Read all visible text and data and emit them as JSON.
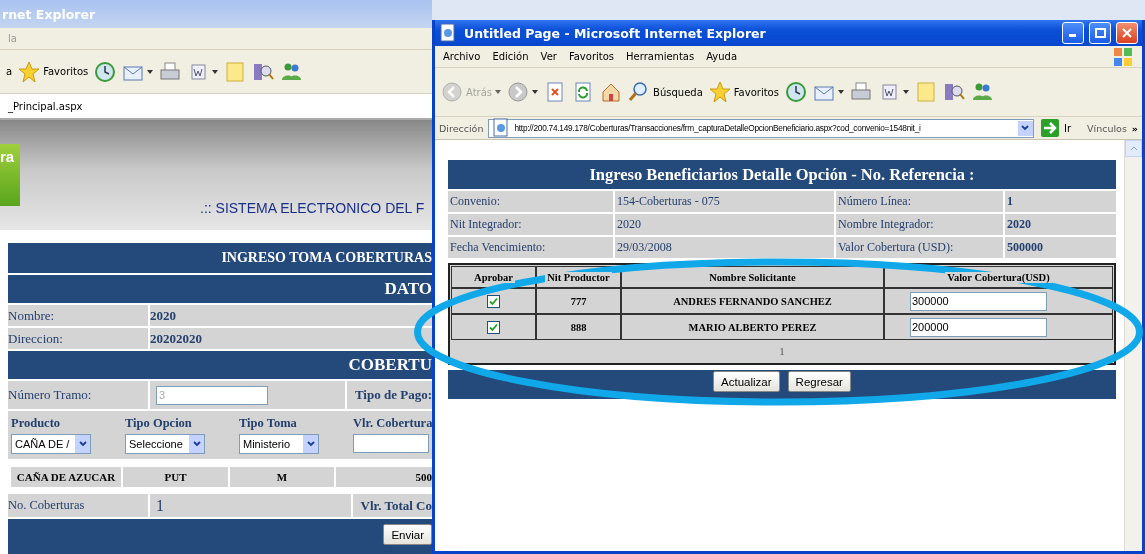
{
  "back_window": {
    "title": "rnet Explorer",
    "menu": [
      "la"
    ],
    "toolbar": [
      {
        "kind": "text",
        "label": "a"
      },
      {
        "kind": "star",
        "label": "Favoritos"
      },
      {
        "kind": "history"
      },
      {
        "kind": "mail",
        "dropdown": true
      },
      {
        "kind": "print"
      },
      {
        "kind": "word",
        "dropdown": true
      },
      {
        "kind": "note"
      },
      {
        "kind": "research"
      },
      {
        "kind": "messenger"
      }
    ],
    "address": "_Principal.aspx",
    "banner": {
      "logo": "ra",
      "title": ".:: SISTEMA ELECTRONICO DEL F"
    },
    "page": {
      "header": "INGRESO TOMA COBERTURAS",
      "section_1": "DATO",
      "fields": [
        {
          "label": "Nombre:",
          "value": "2020"
        },
        {
          "label": "Direccion:",
          "value": "20202020"
        }
      ],
      "section_2": "COBERTU",
      "tramo": {
        "label": "Número Tramo:",
        "value": "3",
        "disabled": true
      },
      "tipo_pago_label": "Tipo de Pago:",
      "selects": [
        {
          "label": "Producto",
          "value": "CAÑA DE /"
        },
        {
          "label": "Tipo Opcion",
          "value": "Seleccione"
        },
        {
          "label": "Tipo Toma",
          "value": "Ministerio"
        }
      ],
      "vlr_label": "Vlr. Cobertura",
      "grid_row": [
        "CAÑA DE AZUCAR",
        "PUT",
        "M",
        "500"
      ],
      "count": {
        "label": "No. Coberturas",
        "value": "1"
      },
      "total_label": "Vlr. Total Co",
      "button": "Enviar"
    }
  },
  "front_window": {
    "title": "Untitled Page - Microsoft Internet Explorer",
    "menu": [
      "Archivo",
      "Edición",
      "Ver",
      "Favoritos",
      "Herramientas",
      "Ayuda"
    ],
    "toolbar": [
      {
        "kind": "back",
        "label": "Atrás",
        "dropdown": true,
        "disabled": true
      },
      {
        "kind": "forward",
        "dropdown": true,
        "disabled": false
      },
      {
        "kind": "stop",
        "disabled": false
      },
      {
        "kind": "refresh",
        "disabled": false
      },
      {
        "kind": "home",
        "disabled": false
      },
      {
        "kind": "search",
        "label": "Búsqueda",
        "disabled": false
      },
      {
        "kind": "star",
        "label": "Favoritos",
        "disabled": false
      },
      {
        "kind": "history",
        "disabled": false
      },
      {
        "kind": "mail",
        "dropdown": true,
        "disabled": false
      },
      {
        "kind": "print",
        "disabled": false
      },
      {
        "kind": "word",
        "dropdown": true,
        "disabled": false
      },
      {
        "kind": "note",
        "disabled": false
      },
      {
        "kind": "research",
        "disabled": false
      },
      {
        "kind": "messenger",
        "disabled": false
      }
    ],
    "address": {
      "label": "Dirección",
      "url": "http://200.74.149.178/Coberturas/Transacciones/frm_capturaDetalleOpcionBeneficiario.aspx?cod_convenio=1548nit_i",
      "go": "Ir",
      "links": "Vínculos",
      "more": "»"
    },
    "page": {
      "title": "Ingreso Beneficiarios Detalle Opción - No. Referencia :",
      "info": [
        [
          {
            "label": "Convenio:",
            "value": "154-Coberturas - 075"
          },
          {
            "label": "Número Línea:",
            "value": "1"
          }
        ],
        [
          {
            "label": "Nit Integrador:",
            "value": "2020"
          },
          {
            "label": "Nombre Integrador:",
            "value": "2020"
          }
        ],
        [
          {
            "label": "Fecha Vencimiento:",
            "value": "29/03/2008"
          },
          {
            "label": "Valor Cobertura (USD):",
            "value": "500000"
          }
        ]
      ],
      "columns": [
        "Aprobar",
        "Nit Productor",
        "Nombre Solicitante",
        "Valor Cobertura(USD)"
      ],
      "rows": [
        {
          "checked": true,
          "nit": "777",
          "name": "ANDRES FERNANDO SANCHEZ",
          "value": "300000"
        },
        {
          "checked": true,
          "nit": "888",
          "name": "MARIO ALBERTO PEREZ",
          "value": "200000"
        }
      ],
      "pager": "1",
      "buttons": [
        "Actualizar",
        "Regresar"
      ]
    }
  }
}
